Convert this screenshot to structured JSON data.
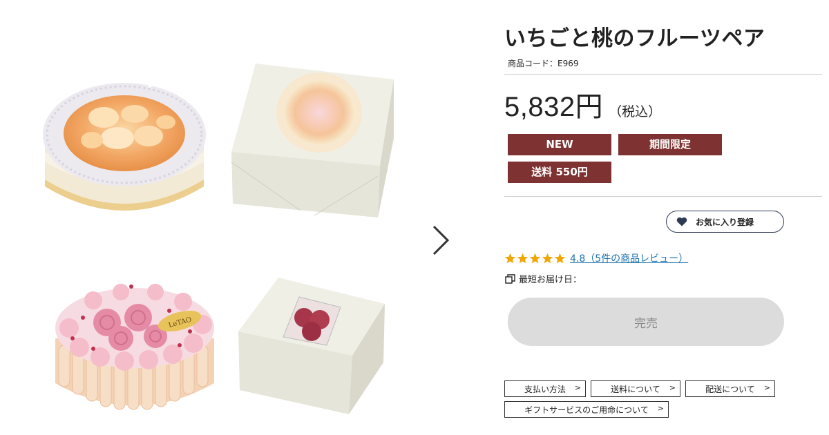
{
  "product": {
    "title": "いちごと桃のフルーツペア",
    "code": "商品コード：E969",
    "price": "5,832円",
    "tax_note": "（税込）",
    "badges": [
      "NEW",
      "期間限定",
      "送料 550円"
    ]
  },
  "favorite": {
    "label": "お気に入り登録"
  },
  "rating": {
    "stars": 5,
    "score_text": "4.8（5件の商品レビュー）"
  },
  "delivery": {
    "label": "最短お届け日："
  },
  "cart": {
    "label": "完売"
  },
  "links": [
    "支払い方法",
    "送料について",
    "配送について",
    "ギフトサービスのご用命について"
  ],
  "gallery": {
    "logo_text": "LeTAO",
    "next_icon": "chevron-right-icon"
  },
  "colors": {
    "badge": "#7e3232",
    "fav_border": "#2e3a55",
    "star": "#f0a500",
    "link": "#1e73b0",
    "soldout_bg": "#dcdcdc"
  }
}
